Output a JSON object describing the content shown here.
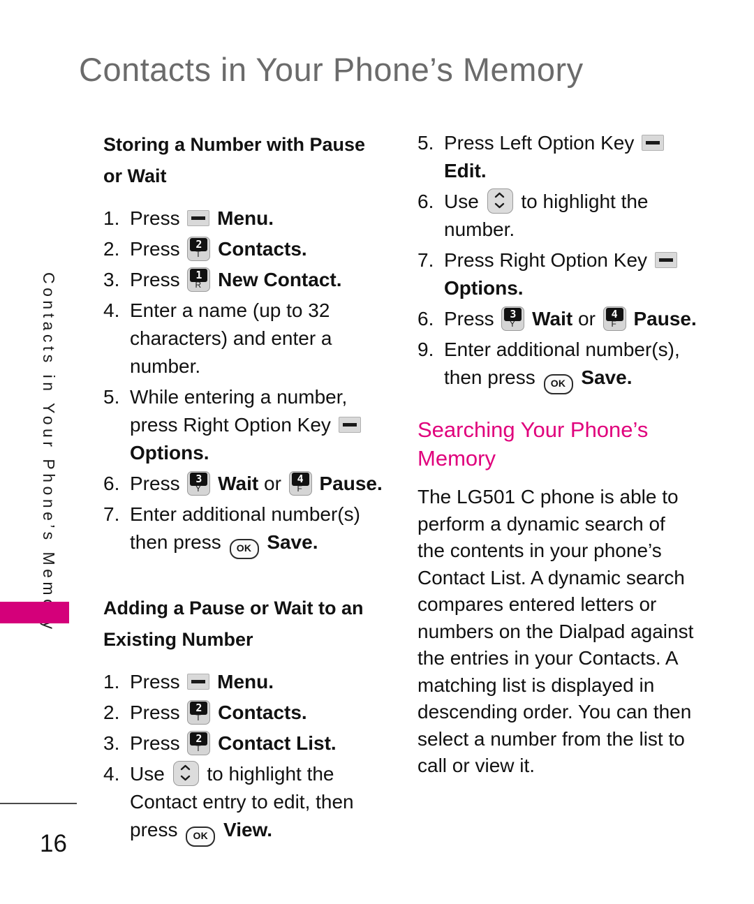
{
  "page": {
    "title": "Contacts in Your Phone’s Memory",
    "side_tab_label": "Contacts in Your Phone’s Memory",
    "page_number": "16",
    "accent_color": "#d4007a",
    "heading_color": "#e0017c",
    "title_color": "#6b6b6b"
  },
  "icons": {
    "option_key": "option-key-icon",
    "key_2_t": {
      "digit": "2",
      "letter": "T"
    },
    "key_1_r": {
      "digit": "1",
      "letter": "R"
    },
    "key_3_y": {
      "digit": "3",
      "letter": "Y"
    },
    "key_4_f": {
      "digit": "4",
      "letter": "F"
    },
    "nav_key": "navigation-key-icon",
    "ok_key": "OK"
  },
  "left_column": {
    "section1": {
      "heading": "Storing a Number with Pause or Wait",
      "steps": [
        {
          "num": "1.",
          "pre": "Press",
          "icon": "option",
          "bold": "Menu.",
          "post": ""
        },
        {
          "num": "2.",
          "pre": "Press",
          "icon": "key2",
          "bold": "Contacts.",
          "post": ""
        },
        {
          "num": "3.",
          "pre": "Press",
          "icon": "key1",
          "bold": "New Contact.",
          "post": ""
        },
        {
          "num": "4.",
          "pre": "Enter a name (up to 32 characters) and enter a number.",
          "icon": "",
          "bold": "",
          "post": ""
        },
        {
          "num": "5.",
          "pre": "While entering a number, press Right Option Key",
          "icon": "option",
          "bold": "Options.",
          "post": ""
        },
        {
          "num": "6.",
          "pre": "Press",
          "icon": "key3",
          "bold": "Wait",
          "mid": "or",
          "icon2": "key4",
          "bold2": "Pause.",
          "post": ""
        },
        {
          "num": "7.",
          "pre": "Enter additional number(s) then press",
          "icon": "ok",
          "bold": "Save.",
          "post": ""
        }
      ]
    },
    "section2": {
      "heading": "Adding a Pause or Wait to an Existing Number",
      "steps": [
        {
          "num": "1.",
          "pre": "Press",
          "icon": "option",
          "bold": "Menu.",
          "post": ""
        },
        {
          "num": "2.",
          "pre": "Press",
          "icon": "key2",
          "bold": "Contacts.",
          "post": ""
        },
        {
          "num": "3.",
          "pre": "Press",
          "icon": "key2",
          "bold": "Contact List.",
          "post": ""
        },
        {
          "num": "4.",
          "pre": "Use",
          "icon": "nav",
          "mid2": "to highlight the Contact entry to edit, then press",
          "icon3": "ok",
          "bold": "View.",
          "post": ""
        }
      ]
    }
  },
  "right_column": {
    "steps_continued": [
      {
        "num": "5.",
        "pre": "Press Left Option Key",
        "icon": "option",
        "bold": "Edit.",
        "post": ""
      },
      {
        "num": "6.",
        "pre": "Use",
        "icon": "nav",
        "mid2": "to highlight the number.",
        "post": ""
      },
      {
        "num": "7.",
        "pre": "Press Right Option Key",
        "icon": "option",
        "bold": "Options.",
        "post": ""
      },
      {
        "num": "6.",
        "pre": "Press",
        "icon": "key3",
        "bold": "Wait",
        "mid": "or",
        "icon2": "key4",
        "bold2": "Pause.",
        "post": ""
      },
      {
        "num": "9.",
        "pre": "Enter additional number(s), then press",
        "icon": "ok",
        "bold": "Save.",
        "post": ""
      }
    ],
    "section": {
      "heading": "Searching Your Phone’s Memory",
      "body": "The LG501 C phone is able to perform a dynamic search of the contents in your phone’s Contact List. A dynamic search compares entered letters or numbers on the Dialpad against the entries in your Contacts. A matching list is displayed in descending order. You can then select a number from the list to call or view it."
    }
  }
}
